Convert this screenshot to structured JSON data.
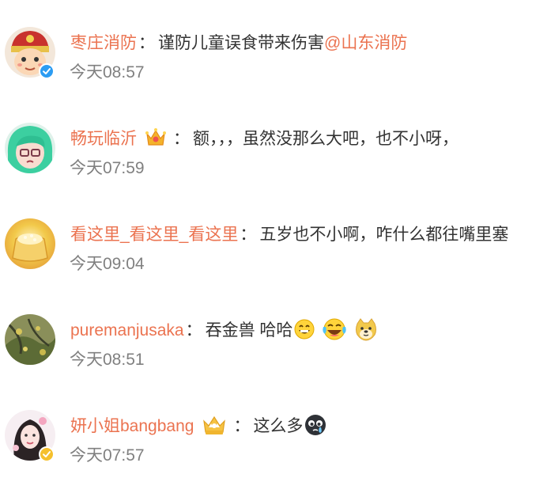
{
  "comments": [
    {
      "username": "枣庄消防",
      "colon": "：",
      "text": "谨防儿童误食带来伤害",
      "mention": "@山东消防",
      "time": "今天08:57",
      "verified": "blue"
    },
    {
      "username": "畅玩临沂",
      "colon": "：",
      "text": "额，，，虽然没那么大吧，也不小呀，",
      "time": "今天07:59",
      "badge": "crown-icon"
    },
    {
      "username": "看这里_看这里_看这里",
      "colon": "：",
      "text": "五岁也不小啊，咋什么都往嘴里塞",
      "time": "今天09:04"
    },
    {
      "username": "puremanjusaka",
      "colon": "：",
      "text": "吞金兽 哈哈",
      "time": "今天08:51",
      "emojis": [
        "grin-emoji-icon",
        "laugh-cry-emoji-icon",
        "doge-emoji-icon"
      ]
    },
    {
      "username": "妍小姐bangbang",
      "colon": "：",
      "text": "这么多",
      "time": "今天07:57",
      "badge": "crown-icon",
      "verified": "gold",
      "emojis": [
        "crying-face-emoji-icon"
      ]
    }
  ],
  "colors": {
    "username": "#eb7350",
    "text": "#333333",
    "time": "#808080",
    "verified_blue": "#2c9cf2",
    "verified_gold": "#f5c02d"
  }
}
